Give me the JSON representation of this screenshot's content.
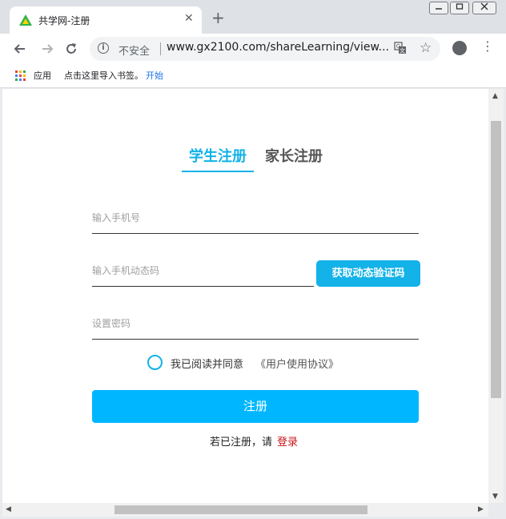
{
  "browser": {
    "tab_title": "共学网-注册",
    "tab_close": "✕",
    "new_tab": "+",
    "security_label": "不安全",
    "url": "www.gx2100.com/shareLearning/view...",
    "bookmarks": {
      "apps": "应用",
      "import_hint": "点击这里导入书签。",
      "start": "开始"
    }
  },
  "register": {
    "tabs": {
      "student": "学生注册",
      "parent": "家长注册"
    },
    "phone_placeholder": "输入手机号",
    "code_placeholder": "输入手机动态码",
    "get_code_label": "获取动态验证码",
    "password_placeholder": "设置密码",
    "agree_text": "我已阅读并同意",
    "agreement_link": "《用户使用协议》",
    "submit_label": "注册",
    "login_prompt": "若已注册，请",
    "login_link": "登录"
  },
  "colors": {
    "accent": "#13b2e8",
    "submit": "#00b7ff",
    "login_link": "#c9141b"
  }
}
